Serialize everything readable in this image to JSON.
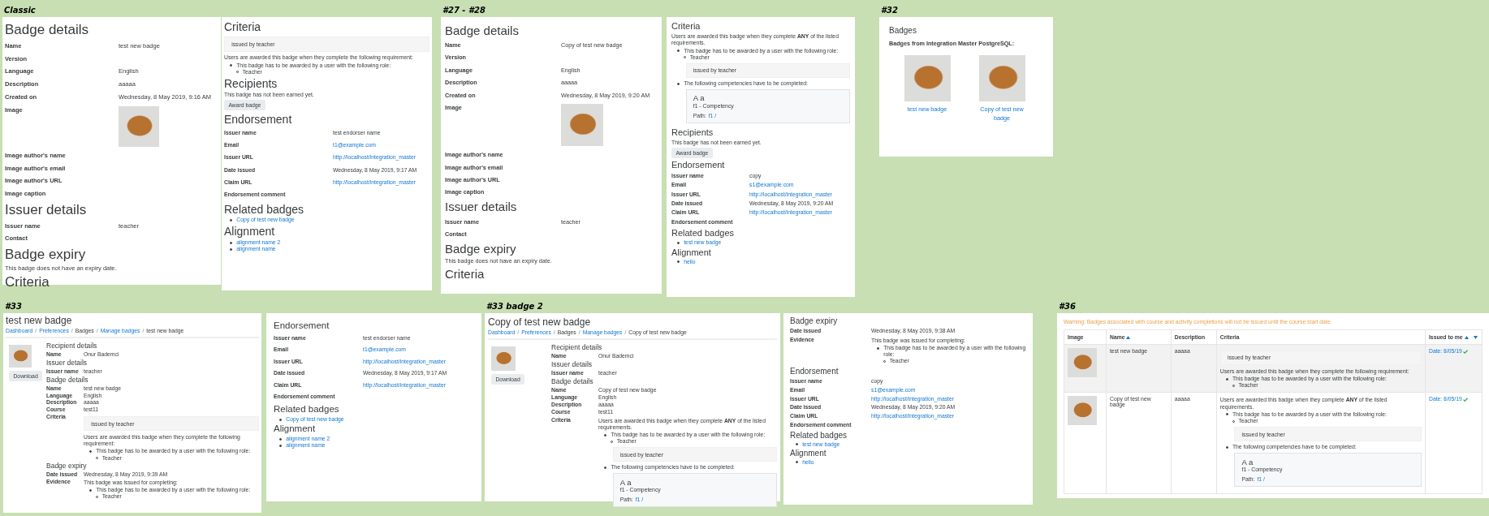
{
  "groups": [
    {
      "caption": "Classic",
      "panels": [
        {
          "blocks": [
            {
              "kind": "heading",
              "text": "Badge details"
            },
            {
              "kind": "field",
              "label": "Name",
              "value": "test new badge"
            },
            {
              "kind": "field",
              "label": "Version"
            },
            {
              "kind": "field",
              "label": "Language",
              "value": "English"
            },
            {
              "kind": "field",
              "label": "Description",
              "value": "aaaaa"
            },
            {
              "kind": "field",
              "label": "Created on",
              "value": "Wednesday, 8 May 2019, 9:16 AM"
            },
            {
              "kind": "field",
              "label": "Image",
              "image": true
            },
            {
              "kind": "field",
              "label": "Image author's name"
            },
            {
              "kind": "field",
              "label": "Image author's email"
            },
            {
              "kind": "field",
              "label": "Image author's URL"
            },
            {
              "kind": "field",
              "label": "Image caption"
            },
            {
              "kind": "heading",
              "text": "Issuer details"
            },
            {
              "kind": "field",
              "label": "Issuer name",
              "value": "teacher"
            },
            {
              "kind": "field",
              "label": "Contact"
            },
            {
              "kind": "heading",
              "text": "Badge expiry"
            },
            {
              "kind": "paragraph",
              "text": "This badge does not have an expiry date."
            },
            {
              "kind": "heading",
              "text": "Criteria"
            }
          ]
        },
        {
          "blocks": [
            {
              "kind": "heading",
              "text": "Criteria"
            },
            {
              "kind": "note_box",
              "text": "issued by teacher"
            },
            {
              "kind": "paragraph",
              "text": "Users are awarded this badge when they complete the following requirement:"
            },
            {
              "kind": "list",
              "items": [
                {
                  "text": "This badge has to be awarded by a user with the following role:",
                  "link": false,
                  "children": [
                    {
                      "text": "Teacher",
                      "link": false
                    }
                  ]
                }
              ]
            },
            {
              "kind": "heading",
              "text": "Recipients"
            },
            {
              "kind": "paragraph",
              "text": "This badge has not been earned yet."
            },
            {
              "kind": "button",
              "label": "Award badge"
            },
            {
              "kind": "heading",
              "text": "Endorsement"
            },
            {
              "kind": "field",
              "label": "Issuer name",
              "value": "test endorser name",
              "link": false
            },
            {
              "kind": "field",
              "label": "Email",
              "value": "t1@example.com",
              "link": true
            },
            {
              "kind": "field",
              "label": "Issuer URL",
              "value": "http://localhost/integration_master",
              "link": true
            },
            {
              "kind": "field",
              "label": "Date issued",
              "value": "Wednesday, 8 May 2019, 9:17 AM",
              "link": false
            },
            {
              "kind": "field",
              "label": "Claim URL",
              "value": "http://localhost/integration_master",
              "link": true
            },
            {
              "kind": "field",
              "label": "Endorsement comment"
            },
            {
              "kind": "heading",
              "text": "Related badges"
            },
            {
              "kind": "list",
              "items": [
                {
                  "text": "Copy of test new badge",
                  "link": true
                }
              ]
            },
            {
              "kind": "heading",
              "text": "Alignment"
            },
            {
              "kind": "list",
              "items": [
                {
                  "text": "alignment name 2",
                  "link": true
                },
                {
                  "text": "alignment name",
                  "link": true
                }
              ]
            }
          ]
        }
      ]
    },
    {
      "caption": "#27 - #28",
      "panels": [
        {
          "blocks": [
            {
              "kind": "heading",
              "text": "Badge details"
            },
            {
              "kind": "field",
              "label": "Name",
              "value": "Copy of test new badge"
            },
            {
              "kind": "field",
              "label": "Version"
            },
            {
              "kind": "field",
              "label": "Language",
              "value": "English"
            },
            {
              "kind": "field",
              "label": "Description",
              "value": "aaaaa"
            },
            {
              "kind": "field",
              "label": "Created on",
              "value": "Wednesday, 8 May 2019, 9:20 AM"
            },
            {
              "kind": "field",
              "label": "Image",
              "image": true
            },
            {
              "kind": "field",
              "label": "Image author's name"
            },
            {
              "kind": "field",
              "label": "Image author's email"
            },
            {
              "kind": "field",
              "label": "Image author's URL"
            },
            {
              "kind": "field",
              "label": "Image caption"
            },
            {
              "kind": "heading",
              "text": "Issuer details"
            },
            {
              "kind": "field",
              "label": "Issuer name",
              "value": "teacher"
            },
            {
              "kind": "field",
              "label": "Contact"
            },
            {
              "kind": "heading",
              "text": "Badge expiry"
            },
            {
              "kind": "paragraph",
              "text": "This badge does not have an expiry date."
            },
            {
              "kind": "heading",
              "text": "Criteria"
            }
          ]
        },
        {
          "blocks": [
            {
              "kind": "heading",
              "text": "Criteria"
            },
            {
              "kind": "paragraph",
              "text": "Users are awarded this badge when they complete **ANY** of the listed requirements."
            },
            {
              "kind": "list",
              "items": [
                {
                  "text": "This badge has to be awarded by a user with the following role:",
                  "link": false,
                  "children": [
                    {
                      "text": "Teacher",
                      "link": false
                    }
                  ],
                  "blocks": [
                    {
                      "kind": "note_box",
                      "text": "issued by teacher"
                    }
                  ]
                },
                {
                  "text": "The following competencies have to be completed:",
                  "link": false,
                  "blocks": [
                    {
                      "kind": "competency",
                      "name": "A a",
                      "code": "f1 - Competency",
                      "path_label": "Path:",
                      "path_value": "f1 /"
                    }
                  ]
                }
              ]
            },
            {
              "kind": "heading",
              "text": "Recipients"
            },
            {
              "kind": "paragraph",
              "text": "This badge has not been earned yet."
            },
            {
              "kind": "button",
              "label": "Award badge"
            },
            {
              "kind": "heading",
              "text": "Endorsement"
            },
            {
              "kind": "field",
              "label": "Issuer name",
              "value": "copy",
              "link": false
            },
            {
              "kind": "field",
              "label": "Email",
              "value": "s1@example.com",
              "link": true
            },
            {
              "kind": "field",
              "label": "Issuer URL",
              "value": "http://localhost/integration_master",
              "link": true
            },
            {
              "kind": "field",
              "label": "Date issued",
              "value": "Wednesday, 8 May 2019, 9:20 AM",
              "link": false
            },
            {
              "kind": "field",
              "label": "Claim URL",
              "value": "http://localhost/integration_master",
              "link": true
            },
            {
              "kind": "field",
              "label": "Endorsement comment"
            },
            {
              "kind": "heading",
              "text": "Related badges"
            },
            {
              "kind": "list",
              "items": [
                {
                  "text": "test new badge",
                  "link": true
                }
              ]
            },
            {
              "kind": "heading",
              "text": "Alignment"
            },
            {
              "kind": "list",
              "items": [
                {
                  "text": "hello",
                  "link": true
                }
              ]
            }
          ]
        }
      ]
    },
    {
      "caption": "#32",
      "panels": [
        {
          "blocks": [
            {
              "kind": "heading",
              "text": "Badges"
            },
            {
              "kind": "subtitle",
              "text": "Badges from Integration Master PostgreSQL:"
            },
            {
              "kind": "badge_grid",
              "items": [
                {
                  "name": "test new badge"
                },
                {
                  "name": "Copy of test new badge"
                }
              ]
            }
          ]
        }
      ]
    },
    {
      "caption": "#33",
      "panels": [
        {
          "blocks": [
            {
              "kind": "title",
              "text": "test new badge"
            },
            {
              "kind": "breadcrumb",
              "separator": "/",
              "items": [
                {
                  "text": "Dashboard",
                  "link": true
                },
                {
                  "text": "Preferences",
                  "link": true
                },
                {
                  "text": "Badges",
                  "link": false
                },
                {
                  "text": "Manage badges",
                  "link": true
                },
                {
                  "text": "test new badge",
                  "link": false
                }
              ]
            },
            {
              "kind": "profile",
              "button": "Download",
              "content": [
                {
                  "kind": "heading",
                  "text": "Recipient details"
                },
                {
                  "kind": "field",
                  "label": "Name",
                  "value": "Onur Bademci"
                },
                {
                  "kind": "heading",
                  "text": "Issuer details"
                },
                {
                  "kind": "field",
                  "label": "Issuer name",
                  "value": "teacher"
                },
                {
                  "kind": "heading",
                  "text": "Badge details"
                },
                {
                  "kind": "field",
                  "label": "Name",
                  "value": "test new badge"
                },
                {
                  "kind": "field",
                  "label": "Language",
                  "value": "English"
                },
                {
                  "kind": "field",
                  "label": "Description",
                  "value": "aaaaa"
                },
                {
                  "kind": "field",
                  "label": "Course",
                  "value": "test11"
                },
                {
                  "kind": "field",
                  "label": "Criteria",
                  "content": [
                    {
                      "kind": "note_box",
                      "text": "issued by teacher"
                    },
                    {
                      "kind": "paragraph",
                      "text": "Users are awarded this badge when they complete the following requirement:"
                    },
                    {
                      "kind": "list",
                      "items": [
                        {
                          "text": "This badge has to be awarded by a user with the following role:",
                          "link": false,
                          "children": [
                            {
                              "text": "Teacher",
                              "link": false
                            }
                          ]
                        }
                      ]
                    }
                  ]
                },
                {
                  "kind": "heading",
                  "text": "Badge expiry"
                },
                {
                  "kind": "field",
                  "label": "Date issued",
                  "value": "Wednesday, 8 May 2019, 9:39 AM"
                },
                {
                  "kind": "field",
                  "label": "Evidence",
                  "content": [
                    {
                      "kind": "paragraph",
                      "text": "This badge was issued for completing:"
                    },
                    {
                      "kind": "list",
                      "items": [
                        {
                          "text": "This badge has to be awarded by a user with the following role:",
                          "link": false,
                          "children": [
                            {
                              "text": "Teacher",
                              "link": false
                            }
                          ]
                        }
                      ]
                    }
                  ]
                }
              ]
            }
          ]
        },
        {
          "blocks": [
            {
              "kind": "heading",
              "text": "Endorsement"
            },
            {
              "kind": "field",
              "label": "Issuer name",
              "value": "test endorser name",
              "link": false
            },
            {
              "kind": "field",
              "label": "Email",
              "value": "t1@example.com",
              "link": true
            },
            {
              "kind": "field",
              "label": "Issuer URL",
              "value": "http://localhost/integration_master",
              "link": true
            },
            {
              "kind": "field",
              "label": "Date issued",
              "value": "Wednesday, 8 May 2019, 9:17 AM",
              "link": false
            },
            {
              "kind": "field",
              "label": "Claim URL",
              "value": "http://localhost/integration_master",
              "link": true
            },
            {
              "kind": "field",
              "label": "Endorsement comment"
            },
            {
              "kind": "heading",
              "text": "Related badges"
            },
            {
              "kind": "list",
              "items": [
                {
                  "text": "Copy of test new badge",
                  "link": true
                }
              ]
            },
            {
              "kind": "heading",
              "text": "Alignment"
            },
            {
              "kind": "list",
              "items": [
                {
                  "text": "alignment name 2",
                  "link": true
                },
                {
                  "text": "alignment name",
                  "link": true
                }
              ]
            }
          ]
        }
      ]
    },
    {
      "caption": "#33 badge 2",
      "panels": [
        {
          "blocks": [
            {
              "kind": "title",
              "text": "Copy of test new badge"
            },
            {
              "kind": "breadcrumb",
              "separator": "/",
              "items": [
                {
                  "text": "Dashboard",
                  "link": true
                },
                {
                  "text": "Preferences",
                  "link": true
                },
                {
                  "text": "Badges",
                  "link": false
                },
                {
                  "text": "Manage badges",
                  "link": true
                },
                {
                  "text": "Copy of test new badge",
                  "link": false
                }
              ]
            },
            {
              "kind": "profile",
              "button": "Download",
              "content": [
                {
                  "kind": "heading",
                  "text": "Recipient details"
                },
                {
                  "kind": "field",
                  "label": "Name",
                  "value": "Onur Bademci"
                },
                {
                  "kind": "heading",
                  "text": "Issuer details"
                },
                {
                  "kind": "field",
                  "label": "Issuer name",
                  "value": "teacher"
                },
                {
                  "kind": "heading",
                  "text": "Badge details"
                },
                {
                  "kind": "field",
                  "label": "Name",
                  "value": "Copy of test new badge"
                },
                {
                  "kind": "field",
                  "label": "Language",
                  "value": "English"
                },
                {
                  "kind": "field",
                  "label": "Description",
                  "value": "aaaaa"
                },
                {
                  "kind": "field",
                  "label": "Course",
                  "value": "test11"
                },
                {
                  "kind": "field",
                  "label": "Criteria",
                  "content": [
                    {
                      "kind": "paragraph",
                      "text": "Users are awarded this badge when they complete **ANY** of the listed requirements."
                    },
                    {
                      "kind": "list",
                      "items": [
                        {
                          "text": "This badge has to be awarded by a user with the following role:",
                          "link": false,
                          "children": [
                            {
                              "text": "Teacher",
                              "link": false
                            }
                          ],
                          "blocks": [
                            {
                              "kind": "note_box",
                              "text": "issued by teacher"
                            }
                          ]
                        },
                        {
                          "text": "The following competencies have to be completed:",
                          "link": false,
                          "blocks": [
                            {
                              "kind": "competency",
                              "name": "A a",
                              "code": "f1 - Competency",
                              "path_label": "Path:",
                              "path_value": "f1 /"
                            }
                          ]
                        }
                      ]
                    }
                  ]
                }
              ]
            }
          ]
        },
        {
          "blocks": [
            {
              "kind": "heading",
              "text": "Badge expiry"
            },
            {
              "kind": "field",
              "label": "Date issued",
              "value": "Wednesday, 8 May 2019, 9:38 AM"
            },
            {
              "kind": "field",
              "label": "Evidence",
              "content": [
                {
                  "kind": "paragraph",
                  "text": "This badge was issued for completing:"
                },
                {
                  "kind": "list",
                  "items": [
                    {
                      "text": "This badge has to be awarded by a user with the following role:",
                      "link": false,
                      "children": [
                        {
                          "text": "Teacher",
                          "link": false
                        }
                      ]
                    }
                  ]
                }
              ]
            },
            {
              "kind": "heading",
              "text": "Endorsement"
            },
            {
              "kind": "field",
              "label": "Issuer name",
              "value": "copy",
              "link": false
            },
            {
              "kind": "field",
              "label": "Email",
              "value": "s1@example.com",
              "link": true
            },
            {
              "kind": "field",
              "label": "Issuer URL",
              "value": "http://localhost/integration_master",
              "link": true
            },
            {
              "kind": "field",
              "label": "Date issued",
              "value": "Wednesday, 8 May 2019, 9:20 AM",
              "link": false
            },
            {
              "kind": "field",
              "label": "Claim URL",
              "value": "http://localhost/integration_master",
              "link": true
            },
            {
              "kind": "field",
              "label": "Endorsement comment"
            },
            {
              "kind": "heading",
              "text": "Related badges"
            },
            {
              "kind": "list",
              "items": [
                {
                  "text": "test new badge",
                  "link": true
                }
              ]
            },
            {
              "kind": "heading",
              "text": "Alignment"
            },
            {
              "kind": "list",
              "items": [
                {
                  "text": "hello",
                  "link": true
                }
              ]
            }
          ]
        }
      ]
    },
    {
      "caption": "#36",
      "panels": [
        {
          "blocks": [
            {
              "kind": "warning",
              "text": "Warning: Badges associated with course and activity completions will not be issued until the course start date."
            },
            {
              "kind": "table",
              "columns": [
                {
                  "label": "Image",
                  "sort": false,
                  "collapse": false
                },
                {
                  "label": "Name",
                  "sort": true,
                  "collapse": false
                },
                {
                  "label": "Description",
                  "sort": false,
                  "collapse": false
                },
                {
                  "label": "Criteria",
                  "sort": false,
                  "collapse": false
                },
                {
                  "label": "Issued to me",
                  "sort": true,
                  "collapse": true
                }
              ],
              "rows": [
                {
                  "name": "test new badge",
                  "description": "aaaaa",
                  "issued": "Date: 8/05/19",
                  "criteria": [
                    {
                      "kind": "note_box",
                      "text": "issued by teacher"
                    },
                    {
                      "kind": "paragraph",
                      "text": "Users are awarded this badge when they complete the following requirement:"
                    },
                    {
                      "kind": "list",
                      "items": [
                        {
                          "text": "This badge has to be awarded by a user with the following role:",
                          "link": false,
                          "children": [
                            {
                              "text": "Teacher",
                              "link": false
                            }
                          ]
                        }
                      ]
                    }
                  ]
                },
                {
                  "name": "Copy of test new badge",
                  "description": "aaaaa",
                  "issued": "Date: 8/05/19",
                  "criteria": [
                    {
                      "kind": "paragraph",
                      "text": "Users are awarded this badge when they complete **ANY** of the listed requirements."
                    },
                    {
                      "kind": "list",
                      "items": [
                        {
                          "text": "This badge has to be awarded by a user with the following role:",
                          "link": false,
                          "children": [
                            {
                              "text": "Teacher",
                              "link": false
                            }
                          ],
                          "blocks": [
                            {
                              "kind": "note_box",
                              "text": "issued by teacher"
                            }
                          ]
                        },
                        {
                          "text": "The following competencies have to be completed:",
                          "link": false,
                          "blocks": [
                            {
                              "kind": "competency",
                              "name": "A a",
                              "code": "f1 - Competency",
                              "path_label": "Path:",
                              "path_value": "f1 /"
                            }
                          ]
                        }
                      ]
                    }
                  ]
                }
              ]
            }
          ]
        }
      ]
    }
  ]
}
